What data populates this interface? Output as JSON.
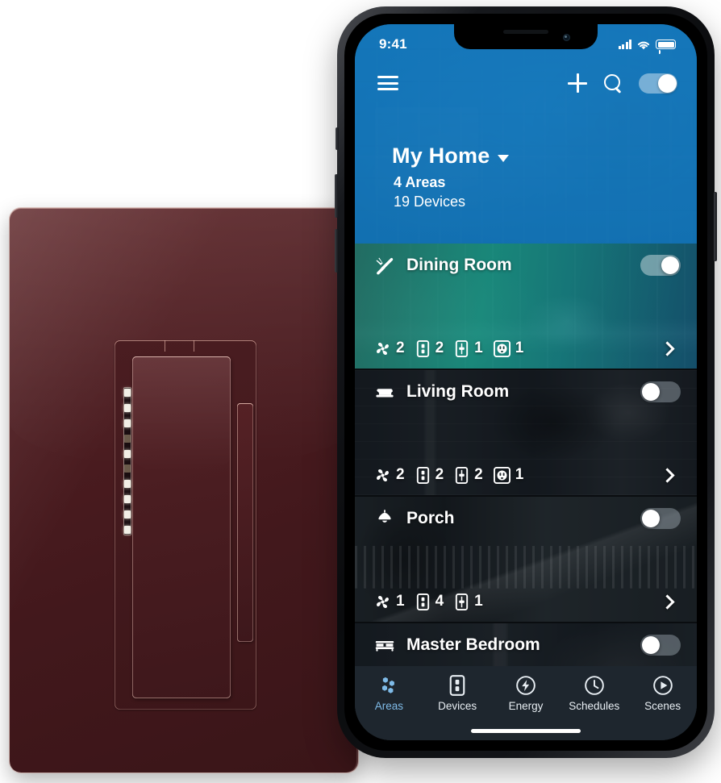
{
  "product": {
    "name": "smart-dimmer-switch",
    "finish_color": "#4a1d21",
    "led_levels": [
      1,
      1,
      1,
      1,
      0,
      1,
      1,
      1,
      1,
      0,
      1
    ],
    "led_active_index": 4
  },
  "phone": {
    "status_bar": {
      "time": "9:41",
      "signal_icon": "cellular-bars-icon",
      "wifi_icon": "wifi-icon",
      "battery_icon": "battery-full-icon"
    },
    "header": {
      "menu_icon": "hamburger-menu-icon",
      "add_icon": "plus-icon",
      "search_icon": "search-icon",
      "master_toggle_state": "on",
      "home_name": "My Home",
      "dropdown_icon": "chevron-down-icon",
      "areas_count": "4 Areas",
      "devices_count": "19 Devices",
      "accent_color": "#1878be"
    },
    "areas": [
      {
        "name": "Dining Room",
        "icon": "cutlery-icon",
        "state": "on",
        "theme": "dining",
        "devices": [
          {
            "icon": "fan-icon",
            "count": "2"
          },
          {
            "icon": "switch-icon",
            "count": "2"
          },
          {
            "icon": "dimmer-icon",
            "count": "1"
          },
          {
            "icon": "outlet-icon",
            "count": "1"
          }
        ],
        "chevron_icon": "chevron-right-icon"
      },
      {
        "name": "Living Room",
        "icon": "sofa-icon",
        "state": "off",
        "theme": "living",
        "devices": [
          {
            "icon": "fan-icon",
            "count": "2"
          },
          {
            "icon": "switch-icon",
            "count": "2"
          },
          {
            "icon": "dimmer-icon",
            "count": "2"
          },
          {
            "icon": "outlet-icon",
            "count": "1"
          }
        ],
        "chevron_icon": "chevron-right-icon"
      },
      {
        "name": "Porch",
        "icon": "pendant-lamp-icon",
        "state": "off",
        "theme": "porch",
        "devices": [
          {
            "icon": "fan-icon",
            "count": "1"
          },
          {
            "icon": "switch-icon",
            "count": "4"
          },
          {
            "icon": "dimmer-icon",
            "count": "1"
          }
        ],
        "chevron_icon": "chevron-right-icon"
      },
      {
        "name": "Master Bedroom",
        "icon": "bed-icon",
        "state": "off",
        "theme": "master",
        "devices": [],
        "chevron_icon": "chevron-right-icon"
      }
    ],
    "tabs": [
      {
        "label": "Areas",
        "icon": "hexagon-cluster-icon",
        "active": true
      },
      {
        "label": "Devices",
        "icon": "switch-icon",
        "active": false
      },
      {
        "label": "Energy",
        "icon": "bolt-circle-icon",
        "active": false
      },
      {
        "label": "Schedules",
        "icon": "clock-icon",
        "active": false
      },
      {
        "label": "Scenes",
        "icon": "play-circle-icon",
        "active": false
      }
    ],
    "active_tab_color": "#7fbbe8"
  }
}
